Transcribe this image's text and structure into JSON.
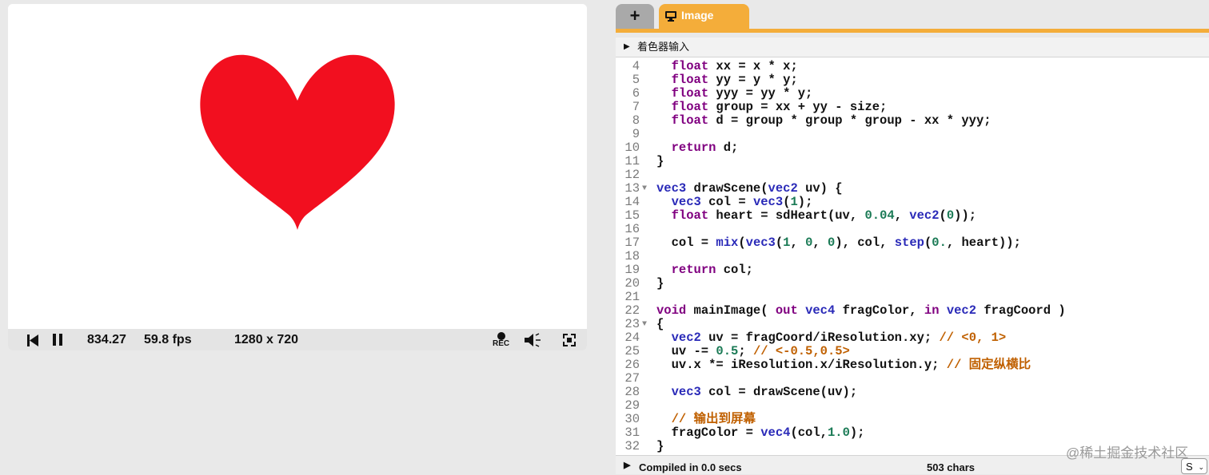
{
  "player": {
    "time": "834.27",
    "fps": "59.8 fps",
    "resolution": "1280 x 720",
    "rec_label": "REC",
    "heart_color": "#f20f1f",
    "icons": [
      "skip-back-icon",
      "pause-icon",
      "record-icon",
      "volume-icon",
      "fullscreen-icon"
    ]
  },
  "tabs": {
    "add_label": "+",
    "image_label": "Image",
    "image_icon": "monitor-icon",
    "active_color": "#f4ad3a"
  },
  "editor": {
    "header_title": "着色器输入",
    "lines": [
      {
        "n": "4",
        "fold": "",
        "tokens": [
          [
            "p",
            "  "
          ],
          [
            "kw",
            "float"
          ],
          [
            "p",
            " xx = x * x;"
          ]
        ]
      },
      {
        "n": "5",
        "fold": "",
        "tokens": [
          [
            "p",
            "  "
          ],
          [
            "kw",
            "float"
          ],
          [
            "p",
            " yy = y * y;"
          ]
        ]
      },
      {
        "n": "6",
        "fold": "",
        "tokens": [
          [
            "p",
            "  "
          ],
          [
            "kw",
            "float"
          ],
          [
            "p",
            " yyy = yy * y;"
          ]
        ]
      },
      {
        "n": "7",
        "fold": "",
        "tokens": [
          [
            "p",
            "  "
          ],
          [
            "kw",
            "float"
          ],
          [
            "p",
            " group = xx + yy - size;"
          ]
        ]
      },
      {
        "n": "8",
        "fold": "",
        "tokens": [
          [
            "p",
            "  "
          ],
          [
            "kw",
            "float"
          ],
          [
            "p",
            " d = group * group * group - xx * yyy;"
          ]
        ]
      },
      {
        "n": "9",
        "fold": "",
        "tokens": []
      },
      {
        "n": "10",
        "fold": "",
        "tokens": [
          [
            "p",
            "  "
          ],
          [
            "kw",
            "return"
          ],
          [
            "p",
            " d;"
          ]
        ]
      },
      {
        "n": "11",
        "fold": "",
        "tokens": [
          [
            "p",
            "}"
          ]
        ]
      },
      {
        "n": "12",
        "fold": "",
        "tokens": []
      },
      {
        "n": "13",
        "fold": "▼",
        "tokens": [
          [
            "type",
            "vec3"
          ],
          [
            "p",
            " drawScene("
          ],
          [
            "type",
            "vec2"
          ],
          [
            "p",
            " uv) {"
          ]
        ]
      },
      {
        "n": "14",
        "fold": "",
        "tokens": [
          [
            "p",
            "  "
          ],
          [
            "type",
            "vec3"
          ],
          [
            "p",
            " col = "
          ],
          [
            "fn",
            "vec3"
          ],
          [
            "p",
            "("
          ],
          [
            "num",
            "1"
          ],
          [
            "p",
            ");"
          ]
        ]
      },
      {
        "n": "15",
        "fold": "",
        "tokens": [
          [
            "p",
            "  "
          ],
          [
            "kw",
            "float"
          ],
          [
            "p",
            " heart = sdHeart(uv, "
          ],
          [
            "num",
            "0.04"
          ],
          [
            "p",
            ", "
          ],
          [
            "fn",
            "vec2"
          ],
          [
            "p",
            "("
          ],
          [
            "num",
            "0"
          ],
          [
            "p",
            "));"
          ]
        ]
      },
      {
        "n": "16",
        "fold": "",
        "tokens": []
      },
      {
        "n": "17",
        "fold": "",
        "tokens": [
          [
            "p",
            "  col = "
          ],
          [
            "fn",
            "mix"
          ],
          [
            "p",
            "("
          ],
          [
            "fn",
            "vec3"
          ],
          [
            "p",
            "("
          ],
          [
            "num",
            "1"
          ],
          [
            "p",
            ", "
          ],
          [
            "num",
            "0"
          ],
          [
            "p",
            ", "
          ],
          [
            "num",
            "0"
          ],
          [
            "p",
            "), col, "
          ],
          [
            "fn",
            "step"
          ],
          [
            "p",
            "("
          ],
          [
            "num",
            "0."
          ],
          [
            "p",
            ", heart));"
          ]
        ]
      },
      {
        "n": "18",
        "fold": "",
        "tokens": []
      },
      {
        "n": "19",
        "fold": "",
        "tokens": [
          [
            "p",
            "  "
          ],
          [
            "kw",
            "return"
          ],
          [
            "p",
            " col;"
          ]
        ]
      },
      {
        "n": "20",
        "fold": "",
        "tokens": [
          [
            "p",
            "}"
          ]
        ]
      },
      {
        "n": "21",
        "fold": "",
        "tokens": []
      },
      {
        "n": "22",
        "fold": "",
        "tokens": [
          [
            "kw",
            "void"
          ],
          [
            "p",
            " mainImage( "
          ],
          [
            "kw",
            "out"
          ],
          [
            "p",
            " "
          ],
          [
            "type",
            "vec4"
          ],
          [
            "p",
            " fragColor, "
          ],
          [
            "kw",
            "in"
          ],
          [
            "p",
            " "
          ],
          [
            "type",
            "vec2"
          ],
          [
            "p",
            " fragCoord )"
          ]
        ]
      },
      {
        "n": "23",
        "fold": "▼",
        "tokens": [
          [
            "p",
            "{"
          ]
        ]
      },
      {
        "n": "24",
        "fold": "",
        "tokens": [
          [
            "p",
            "  "
          ],
          [
            "type",
            "vec2"
          ],
          [
            "p",
            " uv = fragCoord/iResolution.xy; "
          ],
          [
            "cm",
            "// <0, 1>"
          ]
        ]
      },
      {
        "n": "25",
        "fold": "",
        "tokens": [
          [
            "p",
            "  uv -= "
          ],
          [
            "num",
            "0.5"
          ],
          [
            "p",
            "; "
          ],
          [
            "cm",
            "// <-0.5,0.5>"
          ]
        ]
      },
      {
        "n": "26",
        "fold": "",
        "tokens": [
          [
            "p",
            "  uv.x *= iResolution.x/iResolution.y; "
          ],
          [
            "cm",
            "// 固定纵横比"
          ]
        ]
      },
      {
        "n": "27",
        "fold": "",
        "tokens": []
      },
      {
        "n": "28",
        "fold": "",
        "tokens": [
          [
            "p",
            "  "
          ],
          [
            "type",
            "vec3"
          ],
          [
            "p",
            " col = drawScene(uv);"
          ]
        ]
      },
      {
        "n": "29",
        "fold": "",
        "tokens": []
      },
      {
        "n": "30",
        "fold": "",
        "tokens": [
          [
            "p",
            "  "
          ],
          [
            "cm",
            "// 输出到屏幕"
          ]
        ]
      },
      {
        "n": "31",
        "fold": "",
        "tokens": [
          [
            "p",
            "  fragColor = "
          ],
          [
            "fn",
            "vec4"
          ],
          [
            "p",
            "(col,"
          ],
          [
            "num",
            "1.0"
          ],
          [
            "p",
            ");"
          ]
        ]
      },
      {
        "n": "32",
        "fold": "",
        "tokens": [
          [
            "p",
            "}"
          ]
        ]
      }
    ]
  },
  "status": {
    "compiled": "Compiled in 0.0 secs",
    "chars": "503 chars",
    "select_value": "S"
  },
  "watermark": "@稀土掘金技术社区"
}
